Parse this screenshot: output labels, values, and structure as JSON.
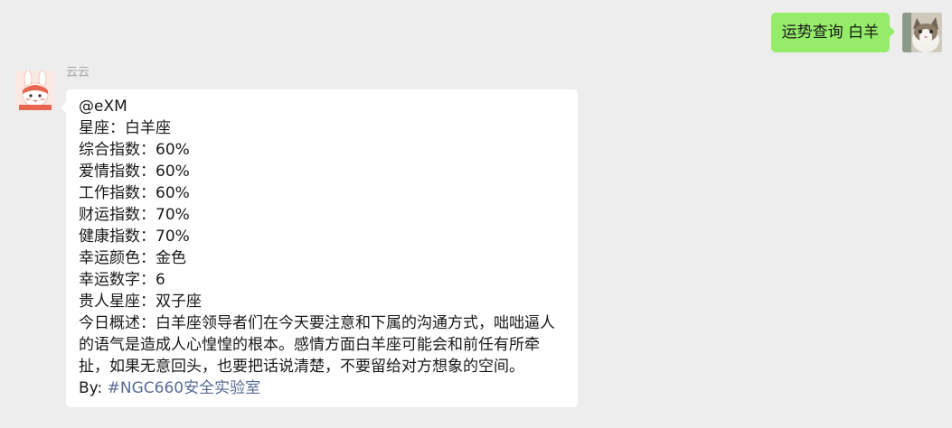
{
  "chat": {
    "outgoing": {
      "text": "运势查询 白羊",
      "avatar_icon": "cat-avatar-icon",
      "bubble_color": "#95ec69"
    },
    "incoming": {
      "sender_name": "云云",
      "avatar_icon": "cartoon-bunny-avatar-icon",
      "lines": {
        "mention": "@eXM",
        "sign": "星座：白羊座",
        "overall": "综合指数：60%",
        "love": "爱情指数：60%",
        "work": "工作指数：60%",
        "wealth": "财运指数：70%",
        "health": "健康指数：70%",
        "lucky_color": "幸运颜色：金色",
        "lucky_number": "幸运数字：6",
        "noble_sign": "贵人星座：双子座",
        "summary": "今日概述：白羊座领导者们在今天要注意和下属的沟通方式，咄咄逼人的语气是造成人心惶惶的根本。感情方面白羊座可能会和前任有所牵扯，如果无意回头，也要把话说清楚，不要留给对方想象的空间。",
        "by_label": "By: ",
        "by_tag": "#NGC660安全实验室"
      },
      "link_color": "#576b95"
    }
  },
  "background_color": "#ededed"
}
